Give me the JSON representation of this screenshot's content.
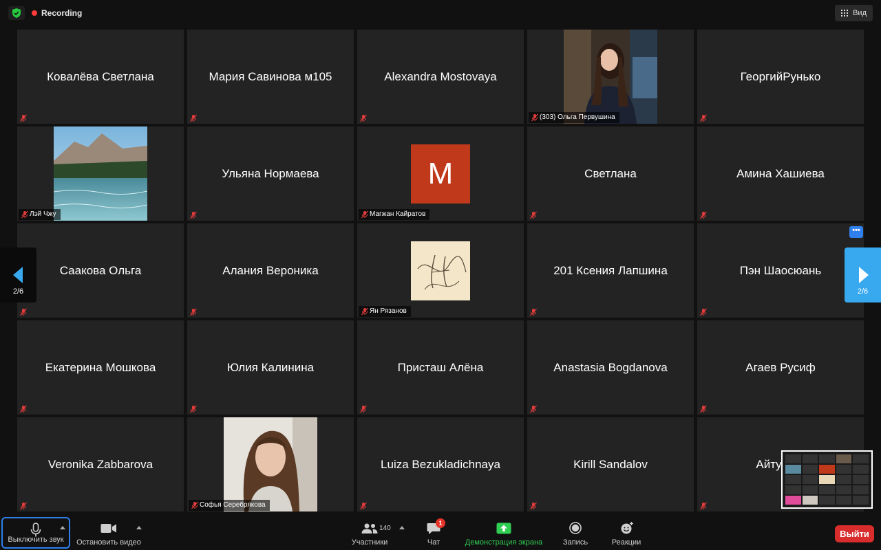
{
  "top": {
    "recording_label": "Recording",
    "view_label": "Вид"
  },
  "tiles": [
    {
      "name": "Ковалёва Светлана",
      "type": "name"
    },
    {
      "name": "Мария Савинова м105",
      "type": "name"
    },
    {
      "name": "Alexandra Mostovaya",
      "type": "name"
    },
    {
      "name": "(303) Ольга Первушина",
      "type": "photo-girl"
    },
    {
      "name": "ГеоргийРунько",
      "type": "name"
    },
    {
      "name": "Лэй Чжу",
      "type": "photo-lake"
    },
    {
      "name": "Ульяна Нормаева",
      "type": "name"
    },
    {
      "name": "Магжан Кайратов",
      "type": "avatar",
      "avatar_letter": "M"
    },
    {
      "name": "Светлана",
      "type": "name"
    },
    {
      "name": "Амина Хашиева",
      "type": "name"
    },
    {
      "name": "Саакова Ольга",
      "type": "name"
    },
    {
      "name": "Алания Вероника",
      "type": "name"
    },
    {
      "name": "Ян Рязанов",
      "type": "photo-calligraphy"
    },
    {
      "name": "201 Ксения Лапшина",
      "type": "name"
    },
    {
      "name": "Пэн Шаосюань",
      "type": "name"
    },
    {
      "name": "Екатерина Мошкова",
      "type": "name"
    },
    {
      "name": "Юлия Калинина",
      "type": "name"
    },
    {
      "name": "Присташ Алёна",
      "type": "name"
    },
    {
      "name": "Anastasia Bogdanova",
      "type": "name"
    },
    {
      "name": "Агаев Русиф",
      "type": "name"
    },
    {
      "name": "Veronika Zabbarova",
      "type": "name"
    },
    {
      "name": "Софья Серебрякова",
      "type": "photo-woman"
    },
    {
      "name": "Luiza Bezukladichnaya",
      "type": "name"
    },
    {
      "name": "Kirill Sandalov",
      "type": "name"
    },
    {
      "name": "Айтурган",
      "type": "name"
    }
  ],
  "nav": {
    "page_left": "2/6",
    "page_right": "2/6"
  },
  "more_button": "•••",
  "toolbar": {
    "mute_label": "Выключить звук",
    "video_label": "Остановить видео",
    "participants_label": "Участники",
    "participants_count": "140",
    "chat_label": "Чат",
    "chat_badge": "1",
    "share_label": "Демонстрация экрана",
    "record_label": "Запись",
    "reactions_label": "Реакции",
    "leave_label": "Выйти"
  },
  "colors": {
    "accent": "#38a9ef",
    "share_green": "#2fcd52",
    "leave_red": "#d92c2c",
    "avatar_orange": "#c0391b",
    "recording_red": "#ff3b3b"
  }
}
